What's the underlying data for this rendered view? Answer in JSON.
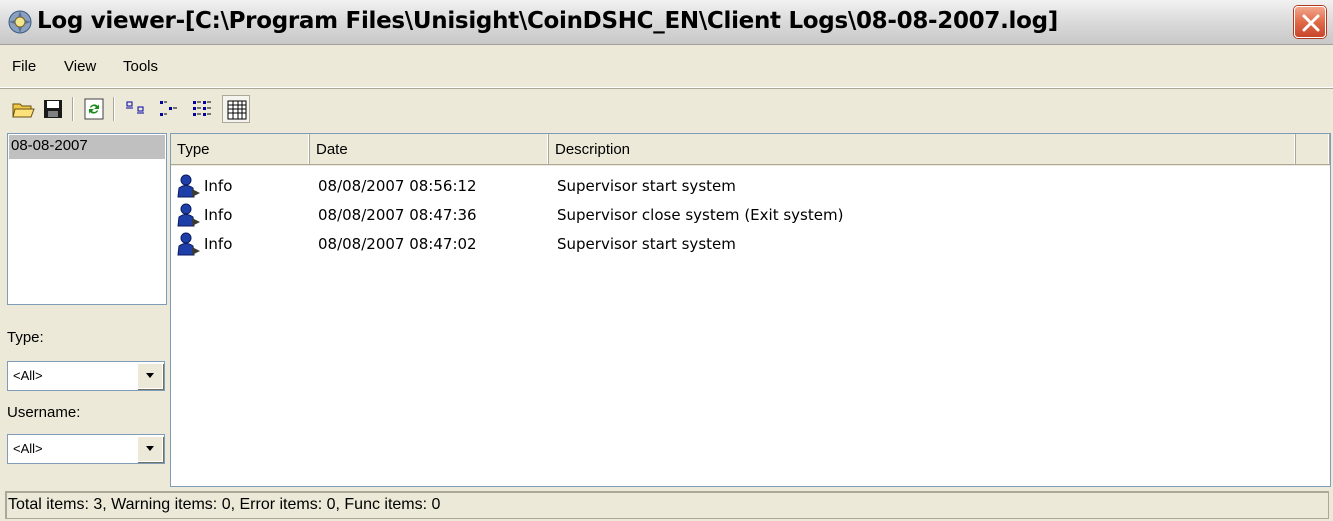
{
  "window": {
    "title": "Log viewer-[C:\\Program Files\\Unisight\\CoinDSHC_EN\\Client Logs\\08-08-2007.log]"
  },
  "menu": {
    "items": [
      "File",
      "View",
      "Tools"
    ]
  },
  "toolbar": {
    "buttons": [
      "open-icon",
      "save-icon",
      "refresh-icon",
      "large-icons-view",
      "small-icons-view",
      "list-view",
      "details-view"
    ],
    "active": "details-view"
  },
  "sidebar": {
    "dates": [
      "08-08-2007"
    ],
    "type_label": "Type:",
    "type_value": "<All>",
    "username_label": "Username:",
    "username_value": "<All>"
  },
  "log_table": {
    "columns": [
      "Type",
      "Date",
      "Description"
    ],
    "rows": [
      {
        "type": "Info",
        "date": "08/08/2007 08:56:12",
        "description": "Supervisor start system"
      },
      {
        "type": "Info",
        "date": "08/08/2007 08:47:36",
        "description": "Supervisor close system (Exit system)"
      },
      {
        "type": "Info",
        "date": "08/08/2007 08:47:02",
        "description": "Supervisor start system"
      }
    ]
  },
  "status": {
    "text": "Total items: 3,  Warning items: 0, Error items: 0, Func items: 0"
  },
  "colors": {
    "chrome": "#ece9d8",
    "border": "#7f9db9",
    "close": "#e06a48",
    "user_icon": "#1f3fa8"
  }
}
